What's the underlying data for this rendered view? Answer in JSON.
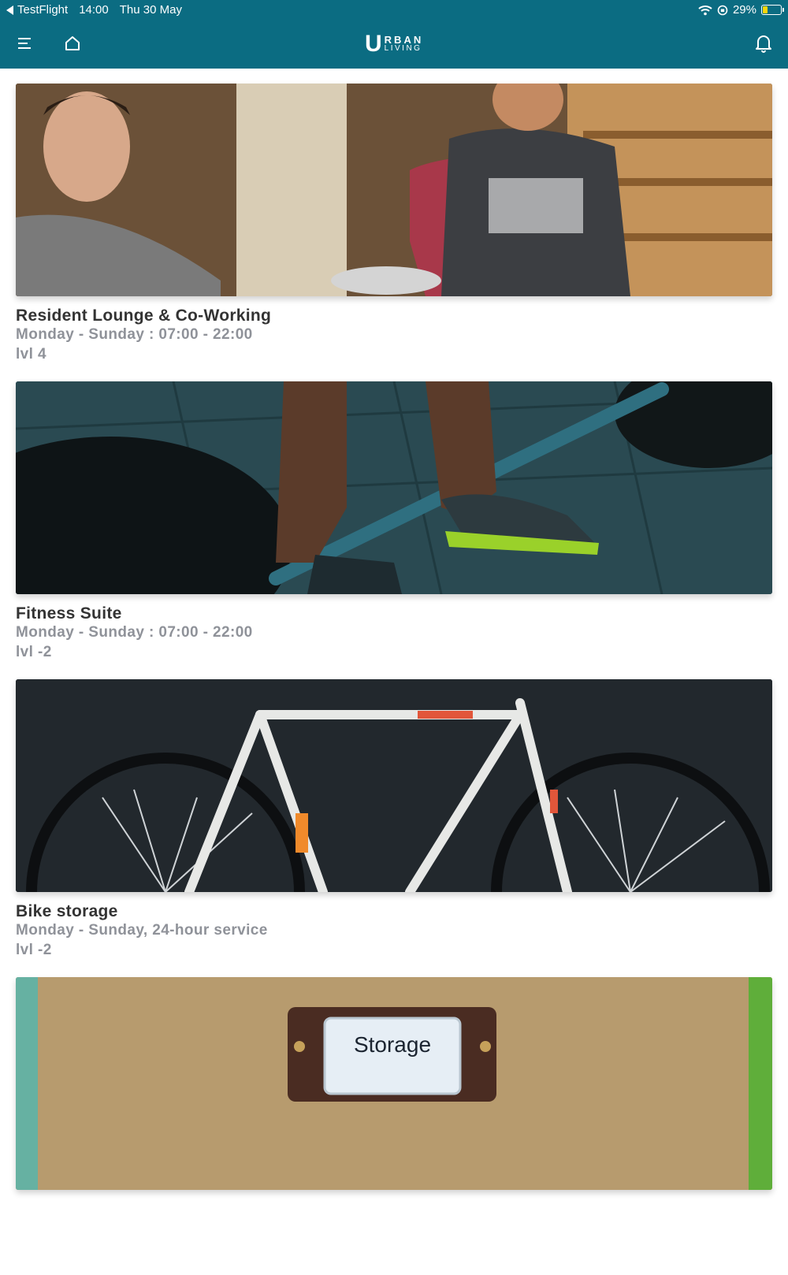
{
  "status": {
    "back_app": "TestFlight",
    "time": "14:00",
    "date": "Thu 30 May",
    "battery": "29%",
    "battery_level": 0.29
  },
  "header": {
    "logo_initial": "U",
    "logo_line1": "RBAN",
    "logo_line2": "LIVING"
  },
  "colors": {
    "header_bg": "#0b6c82",
    "title_text": "#333333",
    "meta_text": "#8f9299"
  },
  "amenities": [
    {
      "title": "Resident Lounge & Co-Working",
      "hours": "Monday - Sunday : 07:00 - 22:00",
      "level": "lvl 4"
    },
    {
      "title": "Fitness Suite",
      "hours": "Monday - Sunday : 07:00 - 22:00",
      "level": "lvl -2"
    },
    {
      "title": "Bike storage",
      "hours": "Monday - Sunday, 24-hour service",
      "level": "lvl -2"
    },
    {
      "image_sign_text": "Storage"
    }
  ]
}
